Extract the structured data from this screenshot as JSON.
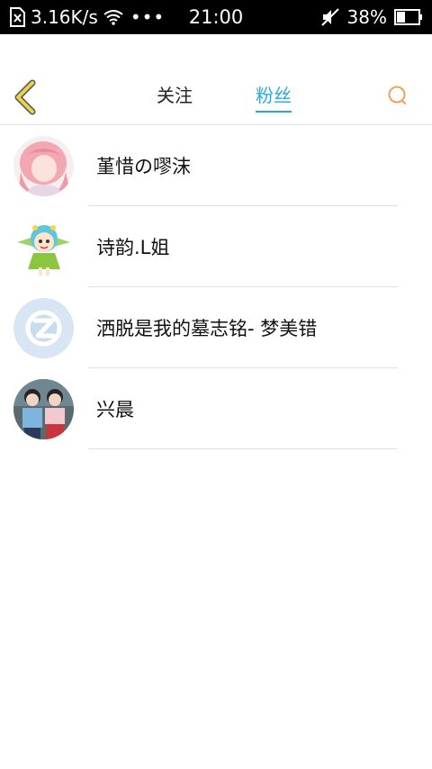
{
  "status_bar": {
    "network_speed": "3.16K/s",
    "more": "•••",
    "time": "21:00",
    "battery_percent": "38%"
  },
  "header": {
    "tabs": [
      {
        "label": "关注",
        "active": false
      },
      {
        "label": "粉丝",
        "active": true
      }
    ]
  },
  "colors": {
    "accent": "#2aa7e0",
    "back_arrow": "#e8d34a",
    "search_icon": "#f0a05a"
  },
  "fans": [
    {
      "name": "堇惜の嘐沫",
      "avatar": "pink-hair-anime-girl"
    },
    {
      "name": "诗韵.L姐",
      "avatar": "green-fairy-cartoon"
    },
    {
      "name": "洒脱是我的墓志铭- 梦美错",
      "avatar": "default-qq-avatar"
    },
    {
      "name": "兴晨",
      "avatar": "two-girls-photo"
    }
  ]
}
